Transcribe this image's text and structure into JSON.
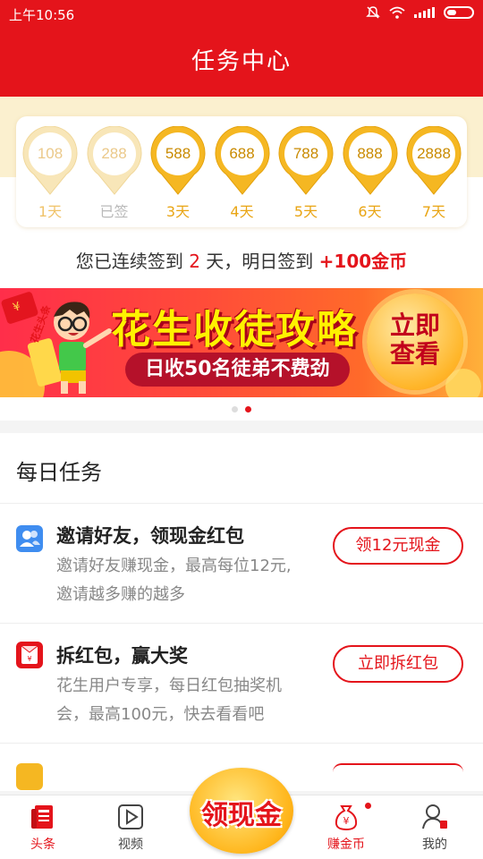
{
  "status_bar": {
    "time": "上午10:56"
  },
  "header": {
    "title": "任务中心"
  },
  "checkin": {
    "days": [
      {
        "value": "108",
        "label": "1天",
        "state": "past"
      },
      {
        "value": "288",
        "label": "已签",
        "state": "signed"
      },
      {
        "value": "588",
        "label": "3天",
        "state": "future"
      },
      {
        "value": "688",
        "label": "4天",
        "state": "future"
      },
      {
        "value": "788",
        "label": "5天",
        "state": "future"
      },
      {
        "value": "888",
        "label": "6天",
        "state": "future"
      },
      {
        "value": "2888",
        "label": "7天",
        "state": "future"
      }
    ],
    "streak_prefix": "您已连续签到",
    "streak_days": "2",
    "streak_mid": "天，明日签到",
    "streak_reward": "+100金币"
  },
  "banner": {
    "badge_text": "花生头条",
    "title": "花生收徒攻略",
    "subtitle": "日收50名徒弟不费劲",
    "cta_line1": "立即",
    "cta_line2": "查看",
    "dots": 2,
    "active_dot": 1
  },
  "daily_tasks": {
    "heading": "每日任务",
    "items": [
      {
        "icon": "contacts-icon",
        "title": "邀请好友，领现金红包",
        "desc_line1": "邀请好友赚现金，最高每位12元,",
        "desc_line2": "邀请越多赚的越多",
        "button": "领12元现金"
      },
      {
        "icon": "red-envelope-icon",
        "title": "拆红包，赢大奖",
        "desc_line1": "花生用户专享，每日红包抽奖机",
        "desc_line2": "会，最高100元，快去看看吧",
        "button": "立即拆红包"
      }
    ]
  },
  "float_button": {
    "label": "领现金"
  },
  "nav": {
    "items": [
      {
        "label": "头条",
        "icon": "news-icon",
        "active": true
      },
      {
        "label": "视频",
        "icon": "play-icon",
        "active": false
      },
      {
        "label": "赚金币",
        "icon": "money-bag-icon",
        "active": true,
        "dot": true
      },
      {
        "label": "我的",
        "icon": "profile-icon",
        "active": false
      }
    ]
  },
  "colors": {
    "primary": "#e4141b",
    "gold": "#f5b722",
    "pale_gold": "#f7dfa0"
  }
}
